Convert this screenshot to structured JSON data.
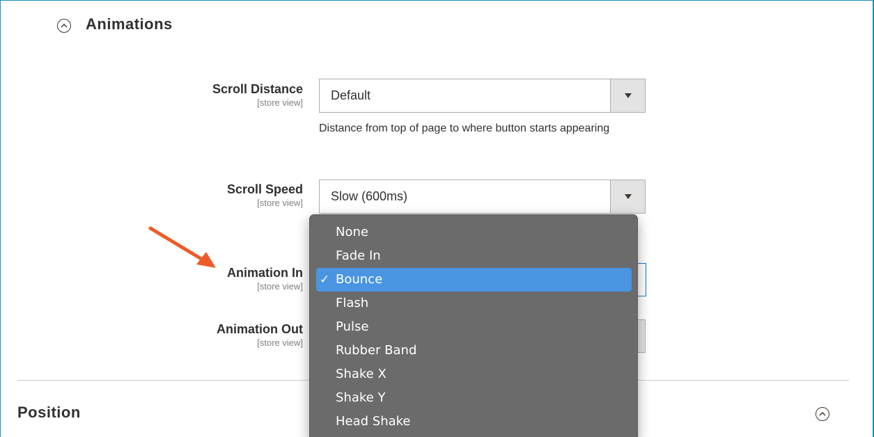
{
  "animations_section": {
    "title": "Animations",
    "toggle_icon": "chevron-up-circle-icon"
  },
  "fields": {
    "scroll_distance": {
      "label": "Scroll Distance",
      "scope": "[store view]",
      "value": "Default",
      "note": "Distance from top of page to where button starts appearing"
    },
    "scroll_speed": {
      "label": "Scroll Speed",
      "scope": "[store view]",
      "value": "Slow (600ms)"
    },
    "animation_in": {
      "label": "Animation In",
      "scope": "[store view]"
    },
    "animation_out": {
      "label": "Animation Out",
      "scope": "[store view]"
    }
  },
  "dropdown": {
    "check_mark": "✓",
    "options": [
      "None",
      "Fade In",
      "Bounce",
      "Flash",
      "Pulse",
      "Rubber Band",
      "Shake X",
      "Shake Y",
      "Head Shake"
    ],
    "selected": "Bounce"
  },
  "position_section": {
    "title": "Position",
    "toggle_icon": "chevron-up-circle-icon"
  },
  "colors": {
    "frame_border": "#1e8fc6",
    "dropdown_bg": "#6b6b6b",
    "selected_bg": "#4a95e2",
    "annotation_arrow": "#f05a28"
  }
}
